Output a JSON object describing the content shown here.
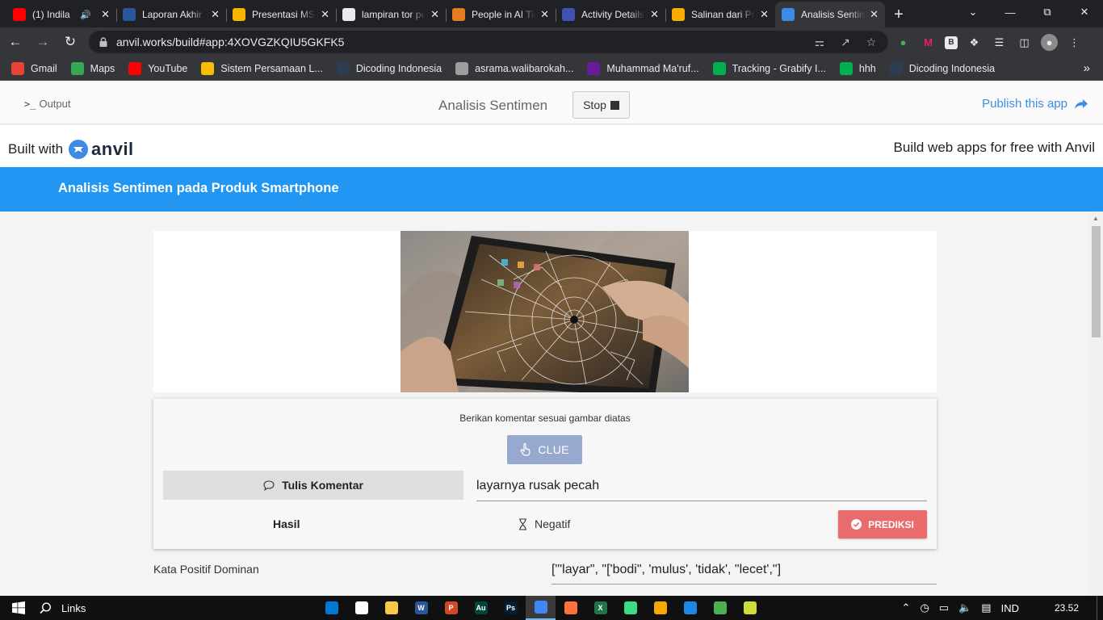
{
  "browser": {
    "tabs": [
      {
        "title": "(1) Indila",
        "icon": "youtube-icon",
        "color": "#ff0000",
        "audio": true,
        "active": false
      },
      {
        "title": "Laporan Akhir",
        "icon": "word-icon",
        "color": "#2b579a",
        "active": false
      },
      {
        "title": "Presentasi MSIB",
        "icon": "slides-icon",
        "color": "#f4b400",
        "active": false
      },
      {
        "title": "lampiran tor per",
        "icon": "globe-icon",
        "color": "#e8eaed",
        "active": false
      },
      {
        "title": "People in AI Tim",
        "icon": "people-icon",
        "color": "#e67c22",
        "active": false
      },
      {
        "title": "Activity Details",
        "icon": "activity-icon",
        "color": "#3f51b5",
        "active": false
      },
      {
        "title": "Salinan dari Pre",
        "icon": "colab-icon",
        "color": "#f9ab00",
        "active": false
      },
      {
        "title": "Analisis Sentimen",
        "icon": "anvil-icon",
        "color": "#3d8be5",
        "active": true
      }
    ],
    "url": "anvil.works/build#app:4XOVGZKQIU5GKFK5",
    "bookmarks": [
      {
        "label": "Gmail",
        "icon": "gmail-icon",
        "color": "#ea4335"
      },
      {
        "label": "Maps",
        "icon": "maps-icon",
        "color": "#34a853"
      },
      {
        "label": "YouTube",
        "icon": "youtube-icon",
        "color": "#ff0000"
      },
      {
        "label": "Sistem Persamaan L...",
        "icon": "bookmark-icon",
        "color": "#fbbc04"
      },
      {
        "label": "Dicoding Indonesia",
        "icon": "dicoding-icon",
        "color": "#2d3e50"
      },
      {
        "label": "asrama.walibarokah...",
        "icon": "house-icon",
        "color": "#9e9e9e"
      },
      {
        "label": "Muhammad Ma'ruf...",
        "icon": "profile-icon",
        "color": "#6a1b9a"
      },
      {
        "label": "Tracking - Grabify I...",
        "icon": "grabify-icon",
        "color": "#00b14f"
      },
      {
        "label": "hhh",
        "icon": "grabify-icon",
        "color": "#00b14f"
      },
      {
        "label": "Dicoding Indonesia",
        "icon": "dicoding-icon",
        "color": "#2d3e50"
      }
    ]
  },
  "ide": {
    "output_label": "Output",
    "app_name": "Analisis Sentimen",
    "stop_label": "Stop",
    "publish_label": "Publish this app"
  },
  "banner": {
    "built_with": "Built with",
    "brand": "anvil",
    "tagline": "Build web apps for free with Anvil"
  },
  "app": {
    "title": "Analisis Sentimen pada Produk Smartphone",
    "instruction": "Berikan komentar sesuai gambar diatas",
    "clue_label": "CLUE",
    "comment_label": "Tulis Komentar",
    "comment_value": "layarnya rusak pecah",
    "result_label": "Hasil",
    "result_value": "Negatif",
    "predict_label": "PREDIKSI",
    "positive_words_label": "Kata Positif Dominan",
    "positive_words_value": "[\"'layar\", \"['bodi\", 'mulus', 'tidak', \"lecet',\"]",
    "header_color": "#2196f3",
    "predict_color": "#ea6b6b",
    "clue_color": "#98a9cf"
  },
  "taskbar": {
    "search_label": "Links",
    "language": "IND",
    "time": "23.52",
    "apps": [
      {
        "icon": "edge-icon",
        "color": "#0078d4"
      },
      {
        "icon": "store-icon",
        "color": "#ffffff"
      },
      {
        "icon": "explorer-icon",
        "color": "#f8c846"
      },
      {
        "icon": "word-icon",
        "color": "#2b579a",
        "letter": "W"
      },
      {
        "icon": "powerpoint-icon",
        "color": "#d24726",
        "letter": "P"
      },
      {
        "icon": "audition-icon",
        "color": "#00463c",
        "letter": "Au"
      },
      {
        "icon": "photoshop-icon",
        "color": "#001e36",
        "letter": "Ps"
      },
      {
        "icon": "chrome-icon",
        "color": "#4285f4",
        "active": true
      },
      {
        "icon": "firefox-icon",
        "color": "#ff7139"
      },
      {
        "icon": "excel-icon",
        "color": "#217346",
        "letter": "X"
      },
      {
        "icon": "android-studio-icon",
        "color": "#3ddc84"
      },
      {
        "icon": "media-player-icon",
        "color": "#f6a800"
      },
      {
        "icon": "app-icon",
        "color": "#1e88e5"
      },
      {
        "icon": "notepad-icon",
        "color": "#4caf50"
      },
      {
        "icon": "folder-icon",
        "color": "#cddc39"
      }
    ]
  }
}
